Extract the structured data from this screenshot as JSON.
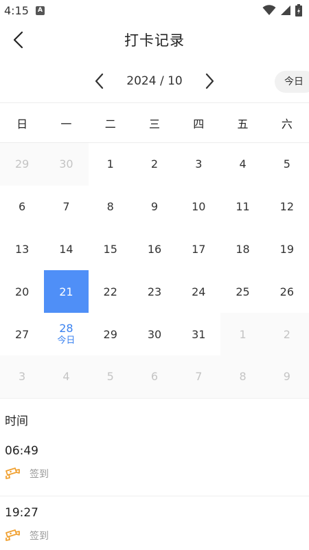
{
  "status_bar": {
    "time": "4:15",
    "app_icon_glyph": "A"
  },
  "app_bar": {
    "title": "打卡记录",
    "back_icon": "chevron-left-icon"
  },
  "month_nav": {
    "label": "2024 / 10",
    "today_label": "今日"
  },
  "weekdays": [
    "日",
    "一",
    "二",
    "三",
    "四",
    "五",
    "六"
  ],
  "calendar": {
    "days": [
      {
        "label": "29",
        "state": "other"
      },
      {
        "label": "30",
        "state": "other"
      },
      {
        "label": "1",
        "state": ""
      },
      {
        "label": "2",
        "state": ""
      },
      {
        "label": "3",
        "state": ""
      },
      {
        "label": "4",
        "state": ""
      },
      {
        "label": "5",
        "state": ""
      },
      {
        "label": "6",
        "state": ""
      },
      {
        "label": "7",
        "state": ""
      },
      {
        "label": "8",
        "state": ""
      },
      {
        "label": "9",
        "state": ""
      },
      {
        "label": "10",
        "state": ""
      },
      {
        "label": "11",
        "state": ""
      },
      {
        "label": "12",
        "state": ""
      },
      {
        "label": "13",
        "state": ""
      },
      {
        "label": "14",
        "state": ""
      },
      {
        "label": "15",
        "state": ""
      },
      {
        "label": "16",
        "state": ""
      },
      {
        "label": "17",
        "state": ""
      },
      {
        "label": "18",
        "state": ""
      },
      {
        "label": "19",
        "state": ""
      },
      {
        "label": "20",
        "state": ""
      },
      {
        "label": "21",
        "state": "selected"
      },
      {
        "label": "22",
        "state": ""
      },
      {
        "label": "23",
        "state": ""
      },
      {
        "label": "24",
        "state": ""
      },
      {
        "label": "25",
        "state": ""
      },
      {
        "label": "26",
        "state": ""
      },
      {
        "label": "27",
        "state": ""
      },
      {
        "label": "28",
        "state": "today",
        "sub": "今日"
      },
      {
        "label": "29",
        "state": ""
      },
      {
        "label": "30",
        "state": ""
      },
      {
        "label": "31",
        "state": ""
      },
      {
        "label": "1",
        "state": "other"
      },
      {
        "label": "2",
        "state": "other"
      },
      {
        "label": "3",
        "state": "other"
      },
      {
        "label": "4",
        "state": "other"
      },
      {
        "label": "5",
        "state": "other"
      },
      {
        "label": "6",
        "state": "other"
      },
      {
        "label": "7",
        "state": "other"
      },
      {
        "label": "8",
        "state": "other"
      },
      {
        "label": "9",
        "state": "other"
      }
    ]
  },
  "records": {
    "title": "时间",
    "items": [
      {
        "time": "06:49",
        "type": "签到",
        "icon": "camera-icon"
      },
      {
        "time": "19:27",
        "type": "签到",
        "icon": "camera-icon"
      }
    ]
  },
  "colors": {
    "accent": "#4f8ff7",
    "today_text": "#3a82f0",
    "record_icon": "#f0a030"
  }
}
